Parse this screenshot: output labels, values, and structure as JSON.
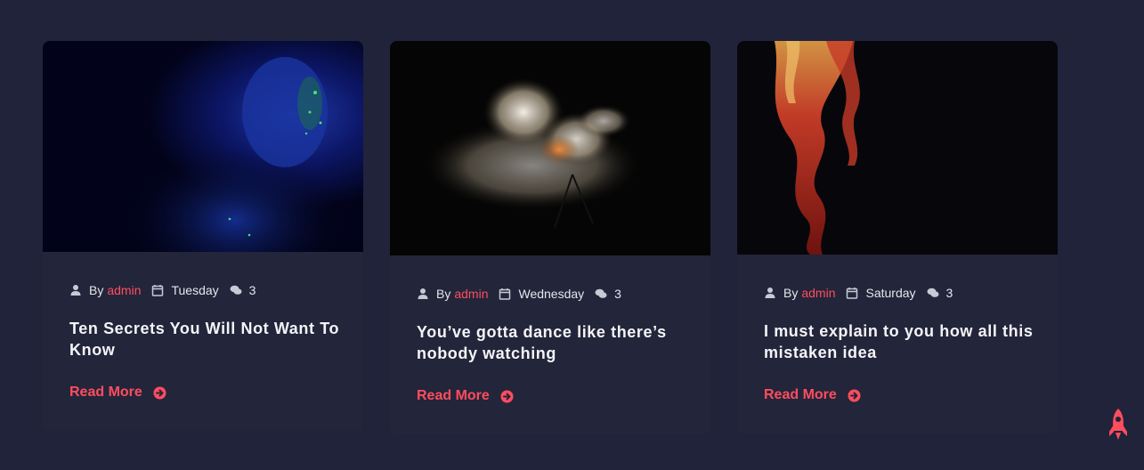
{
  "posts": [
    {
      "by_label": "By",
      "author": "admin",
      "day": "Tuesday",
      "comments": "3",
      "title": "Ten Secrets You Will Not Want To Know",
      "read_more": "Read More"
    },
    {
      "by_label": "By",
      "author": "admin",
      "day": "Wednesday",
      "comments": "3",
      "title": "You’ve gotta dance like there’s nobody watching",
      "read_more": "Read More"
    },
    {
      "by_label": "By",
      "author": "admin",
      "day": "Saturday",
      "comments": "3",
      "title": "I must explain to you how all this mistaken idea",
      "read_more": "Read More"
    }
  ],
  "colors": {
    "background": "#20233a",
    "card": "#23253a",
    "accent": "#ff4d5e",
    "text": "#f4f4f8"
  },
  "icons": {
    "author": "user-icon",
    "date": "calendar-icon",
    "comments": "comments-icon",
    "read_more": "arrow-circle-right-icon",
    "scroll_top": "rocket-icon"
  }
}
